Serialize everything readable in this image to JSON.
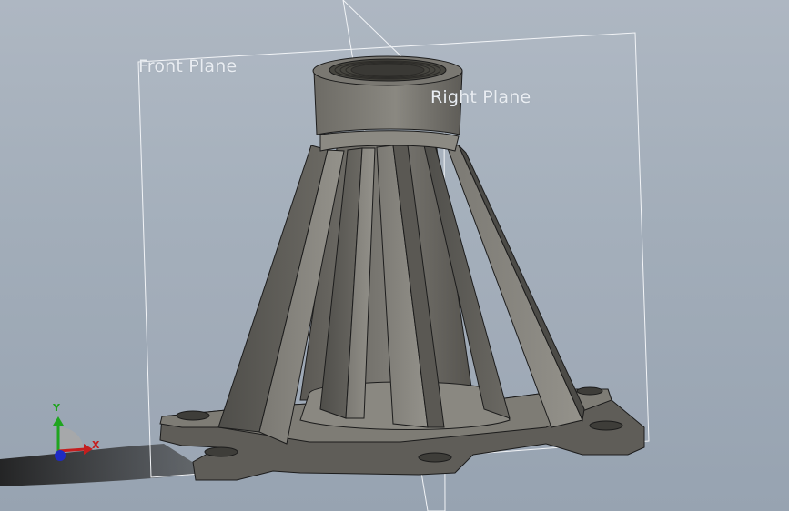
{
  "viewport": {
    "background_top": "#aeb7c2",
    "background_bottom": "#97a3b1"
  },
  "planes": {
    "front_label": "Front Plane",
    "right_label": "Right Plane",
    "outline_color": "#f2f4f7"
  },
  "model": {
    "body_color": "#66645e",
    "shadow_color": "#2a2a2a",
    "edge_color": "#1c1c1c"
  },
  "triad": {
    "y_label": "Y",
    "x_label": "X",
    "y_color": "#1fa51f",
    "x_color": "#c41e1e",
    "z_color": "#1f2bc4"
  }
}
